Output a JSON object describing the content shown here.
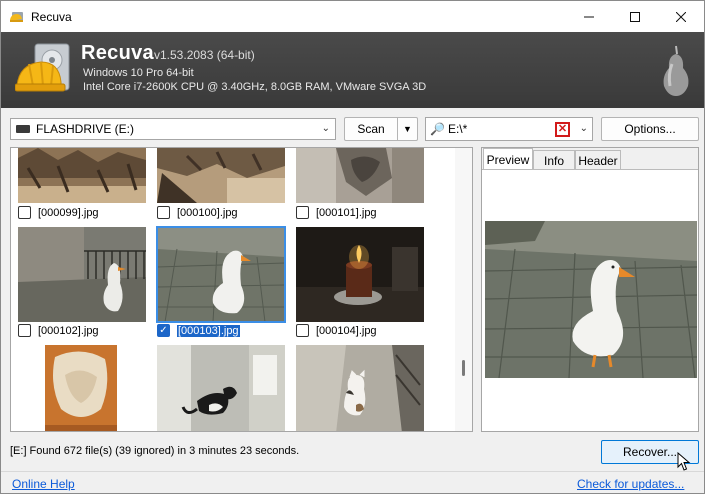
{
  "window": {
    "title": "Recuva"
  },
  "header": {
    "app_name": "Recuva",
    "version": "v1.53.2083 (64-bit)",
    "os": "Windows 10 Pro 64-bit",
    "cpu": "Intel Core i7-2600K CPU @ 3.40GHz, 8.0GB RAM, VMware SVGA 3D"
  },
  "toolbar": {
    "drive": "FLASHDRIVE (E:)",
    "scan_label": "Scan",
    "filter_value": "E:\\*",
    "options_label": "Options..."
  },
  "files": [
    {
      "name": "[000099].jpg",
      "checked": false,
      "selected": false
    },
    {
      "name": "[000100].jpg",
      "checked": false,
      "selected": false
    },
    {
      "name": "[000101].jpg",
      "checked": false,
      "selected": false
    },
    {
      "name": "[000102].jpg",
      "checked": false,
      "selected": false
    },
    {
      "name": "[000103].jpg",
      "checked": true,
      "selected": true
    },
    {
      "name": "[000104].jpg",
      "checked": false,
      "selected": false
    }
  ],
  "preview": {
    "tabs": [
      "Preview",
      "Info",
      "Header"
    ],
    "active_tab": "Preview"
  },
  "status": "[E:] Found 672 file(s) (39 ignored) in 3 minutes 23 seconds.",
  "recover_label": "Recover...",
  "footer": {
    "help_link": "Online Help",
    "updates_link": "Check for updates..."
  }
}
